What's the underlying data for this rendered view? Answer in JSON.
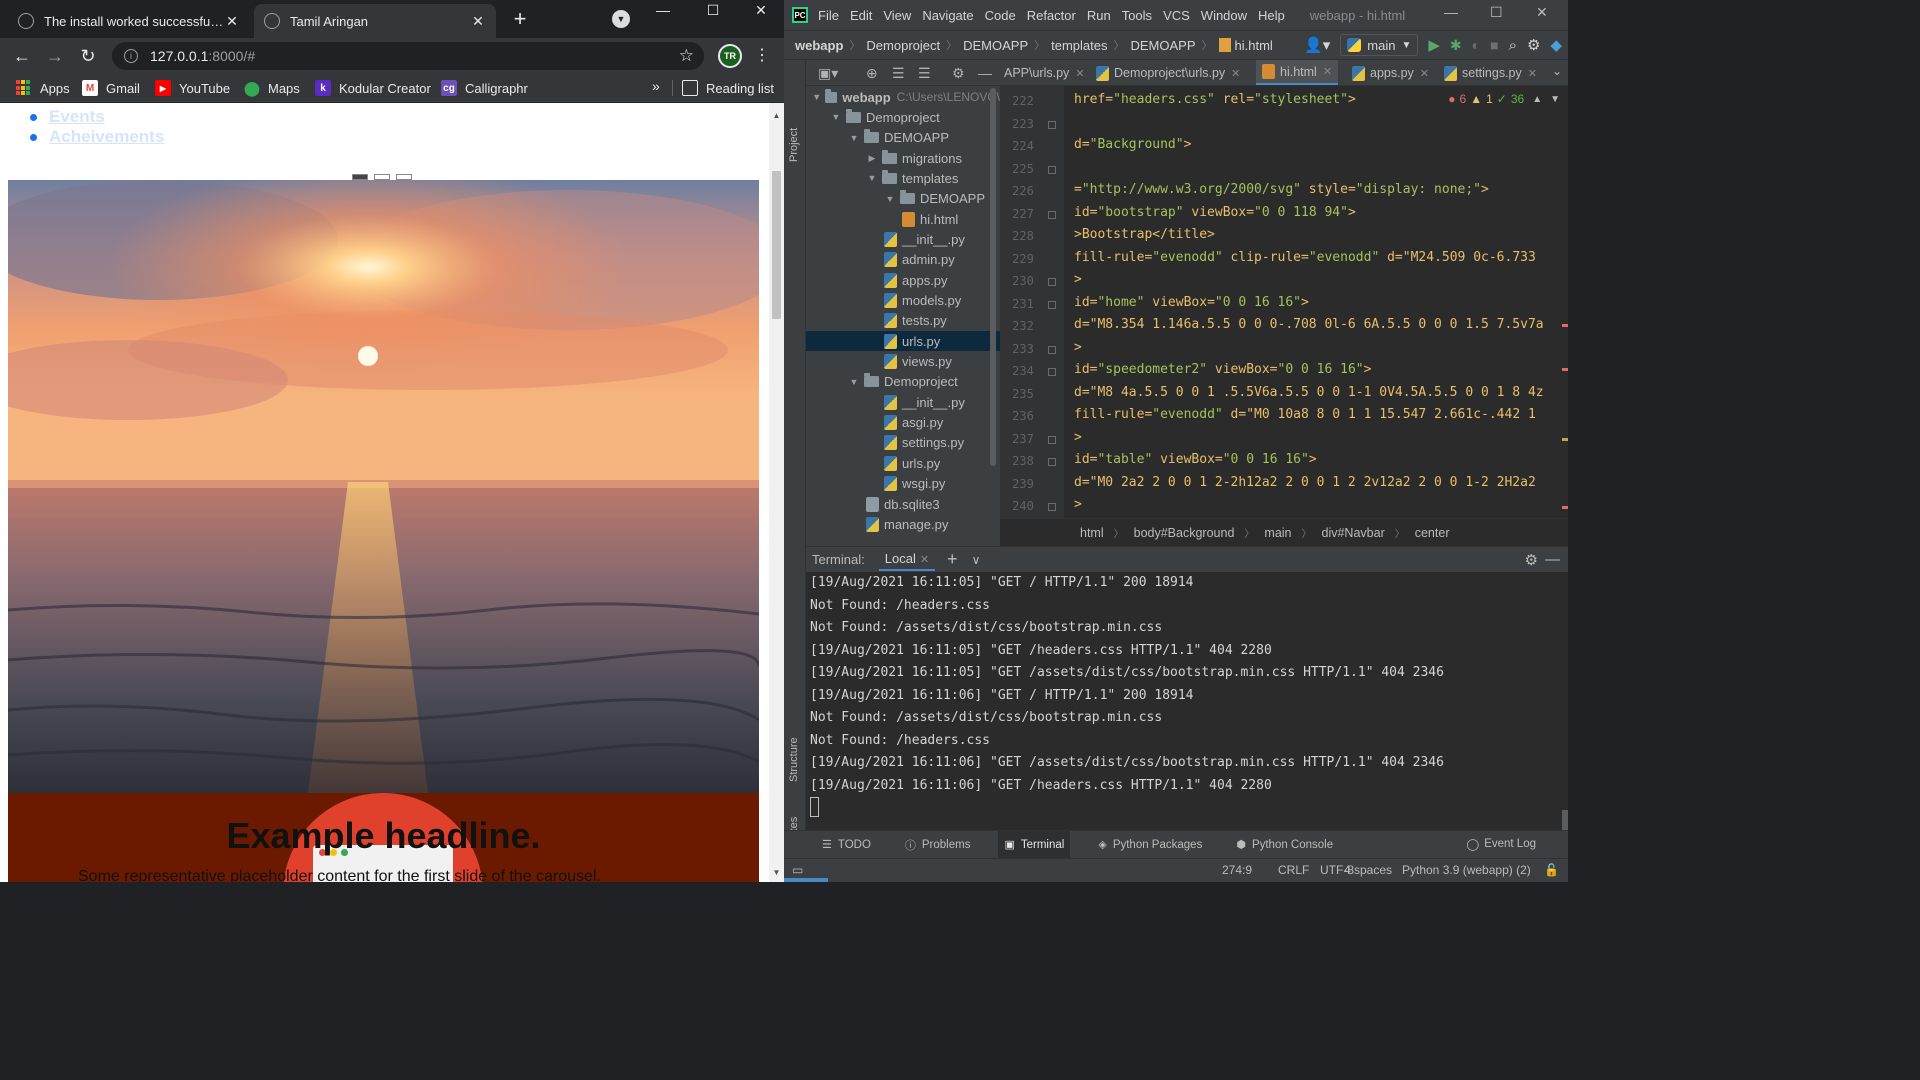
{
  "browser": {
    "tabs": [
      {
        "title": "The install worked successfully! C",
        "active": false
      },
      {
        "title": "Tamil Aringan",
        "active": true
      }
    ],
    "url_host": "127.0.0.1",
    "url_rest": ":8000/#",
    "bookmarks": [
      "Apps",
      "Gmail",
      "YouTube",
      "Maps",
      "Kodular Creator",
      "Calligraphr"
    ],
    "more_bookmarks": "»",
    "reading_list": "Reading list",
    "page": {
      "nav_links": [
        "Events",
        "Acheivements"
      ],
      "headline": "Example headline.",
      "subline": "Some representative placeholder content for the first slide of the carousel."
    }
  },
  "ide": {
    "menu": [
      "File",
      "Edit",
      "View",
      "Navigate",
      "Code",
      "Refactor",
      "Run",
      "Tools",
      "VCS",
      "Window",
      "Help"
    ],
    "title": "webapp - hi.html",
    "breadcrumbs": [
      "webapp",
      "Demoproject",
      "DEMOAPP",
      "templates",
      "DEMOAPP",
      "hi.html"
    ],
    "branch": "main",
    "tool_window_labels": {
      "project": "Project",
      "structure": "Structure",
      "favorites": "Favorites"
    },
    "tree": [
      {
        "label": "webapp",
        "path": "C:\\Users\\LENOVO\\",
        "type": "folder",
        "depth": 0,
        "open": true
      },
      {
        "label": "Demoproject",
        "type": "folder",
        "depth": 1,
        "open": true
      },
      {
        "label": "DEMOAPP",
        "type": "folder",
        "depth": 2,
        "open": true
      },
      {
        "label": "migrations",
        "type": "folder",
        "depth": 3,
        "open": false
      },
      {
        "label": "templates",
        "type": "folder",
        "depth": 3,
        "open": true
      },
      {
        "label": "DEMOAPP",
        "type": "folder",
        "depth": 4,
        "open": true
      },
      {
        "label": "hi.html",
        "type": "html",
        "depth": 5
      },
      {
        "label": "__init__.py",
        "type": "py",
        "depth": 4
      },
      {
        "label": "admin.py",
        "type": "py",
        "depth": 4
      },
      {
        "label": "apps.py",
        "type": "py",
        "depth": 4
      },
      {
        "label": "models.py",
        "type": "py",
        "depth": 4
      },
      {
        "label": "tests.py",
        "type": "py",
        "depth": 4
      },
      {
        "label": "urls.py",
        "type": "py",
        "depth": 4,
        "selected": true
      },
      {
        "label": "views.py",
        "type": "py",
        "depth": 4
      },
      {
        "label": "Demoproject",
        "type": "folder",
        "depth": 2,
        "open": true
      },
      {
        "label": "__init__.py",
        "type": "py",
        "depth": 4
      },
      {
        "label": "asgi.py",
        "type": "py",
        "depth": 4
      },
      {
        "label": "settings.py",
        "type": "py",
        "depth": 4
      },
      {
        "label": "urls.py",
        "type": "py",
        "depth": 4
      },
      {
        "label": "wsgi.py",
        "type": "py",
        "depth": 4
      },
      {
        "label": "db.sqlite3",
        "type": "db",
        "depth": 3
      },
      {
        "label": "manage.py",
        "type": "py",
        "depth": 3
      }
    ],
    "editor_tabs": [
      {
        "label": "APP\\urls.py",
        "active": false
      },
      {
        "label": "Demoproject\\urls.py",
        "active": false
      },
      {
        "label": "hi.html",
        "active": true
      },
      {
        "label": "apps.py",
        "active": false
      },
      {
        "label": "settings.py",
        "active": false
      }
    ],
    "inspections": {
      "errors": "6",
      "warnings": "1",
      "ok": "36"
    },
    "code_lines": [
      {
        "n": "222",
        "text": "href=\"headers.css\" rel=\"stylesheet\">"
      },
      {
        "n": "223",
        "text": ""
      },
      {
        "n": "224",
        "text": "d=\"Background\">"
      },
      {
        "n": "225",
        "text": ""
      },
      {
        "n": "226",
        "text": "=\"http://www.w3.org/2000/svg\" style=\"display: none;\">"
      },
      {
        "n": "227",
        "text": "id=\"bootstrap\" viewBox=\"0 0 118 94\">"
      },
      {
        "n": "228",
        "text": ">Bootstrap</title>"
      },
      {
        "n": "229",
        "text": "fill-rule=\"evenodd\" clip-rule=\"evenodd\" d=\"M24.509 0c-6.733"
      },
      {
        "n": "230",
        "text": ">"
      },
      {
        "n": "231",
        "text": "id=\"home\" viewBox=\"0 0 16 16\">"
      },
      {
        "n": "232",
        "text": "d=\"M8.354 1.146a.5.5 0 0 0-.708 0l-6 6A.5.5 0 0 0 1.5 7.5v7a"
      },
      {
        "n": "233",
        "text": ">"
      },
      {
        "n": "234",
        "text": "id=\"speedometer2\" viewBox=\"0 0 16 16\">"
      },
      {
        "n": "235",
        "text": "d=\"M8 4a.5.5 0 0 1 .5.5V6a.5.5 0 0 1-1 0V4.5A.5.5 0 0 1 8 4z"
      },
      {
        "n": "236",
        "text": "fill-rule=\"evenodd\" d=\"M0 10a8 8 0 1 1 15.547 2.661c-.442 1"
      },
      {
        "n": "237",
        "text": ">"
      },
      {
        "n": "238",
        "text": "id=\"table\" viewBox=\"0 0 16 16\">"
      },
      {
        "n": "239",
        "text": "d=\"M0 2a2 2 0 0 1 2-2h12a2 2 0 0 1 2 2v12a2 2 0 0 1-2 2H2a2"
      },
      {
        "n": "240",
        "text": ">"
      }
    ],
    "code_breadcrumbs": [
      "html",
      "body#Background",
      "main",
      "div#Navbar",
      "center"
    ],
    "terminal": {
      "label": "Terminal:",
      "tab": "Local",
      "lines": [
        "[19/Aug/2021 16:11:05] \"GET / HTTP/1.1\" 200 18914",
        "Not Found: /headers.css",
        "Not Found: /assets/dist/css/bootstrap.min.css",
        "[19/Aug/2021 16:11:05] \"GET /headers.css HTTP/1.1\" 404 2280",
        "[19/Aug/2021 16:11:05] \"GET /assets/dist/css/bootstrap.min.css HTTP/1.1\" 404 2346",
        "[19/Aug/2021 16:11:06] \"GET / HTTP/1.1\" 200 18914",
        "Not Found: /assets/dist/css/bootstrap.min.css",
        "Not Found: /headers.css",
        "[19/Aug/2021 16:11:06] \"GET /assets/dist/css/bootstrap.min.css HTTP/1.1\" 404 2346",
        "[19/Aug/2021 16:11:06] \"GET /headers.css HTTP/1.1\" 404 2280"
      ]
    },
    "tool_windows": [
      "TODO",
      "Problems",
      "Terminal",
      "Python Packages",
      "Python Console"
    ],
    "event_log": "Event Log",
    "status": {
      "position": "274:9",
      "line_sep": "CRLF",
      "encoding": "UTF-8",
      "indent": "4 spaces",
      "interpreter": "Python 3.9 (webapp) (2)"
    }
  }
}
